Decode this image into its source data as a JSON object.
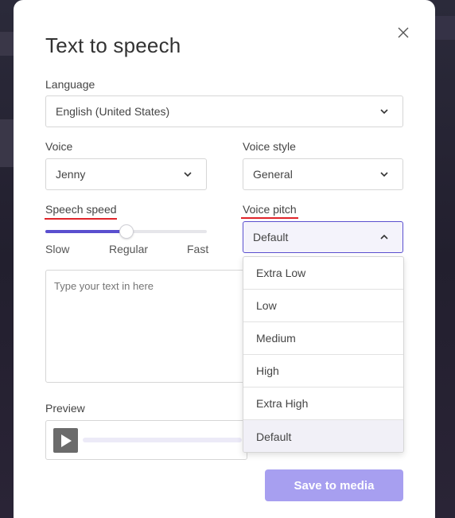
{
  "dialog": {
    "title": "Text to speech",
    "close_icon": "close-icon"
  },
  "language": {
    "label": "Language",
    "value": "English (United States)"
  },
  "voice": {
    "label": "Voice",
    "value": "Jenny"
  },
  "voice_style": {
    "label": "Voice style",
    "value": "General"
  },
  "speech_speed": {
    "label": "Speech speed",
    "ticks": [
      "Slow",
      "Regular",
      "Fast"
    ],
    "value_fraction": 0.5
  },
  "voice_pitch": {
    "label": "Voice pitch",
    "value": "Default",
    "options": [
      "Extra Low",
      "Low",
      "Medium",
      "High",
      "Extra High",
      "Default"
    ],
    "selected_index": 5
  },
  "text_input": {
    "placeholder": "Type your text in here"
  },
  "preview": {
    "label": "Preview"
  },
  "actions": {
    "save_label": "Save to media"
  },
  "colors": {
    "accent": "#5a4fcf",
    "save_button": "#a79ff0",
    "annotation_underline": "#e0242a"
  }
}
